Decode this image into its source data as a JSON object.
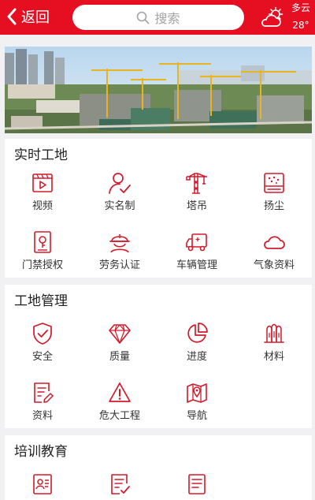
{
  "header": {
    "back_label": "返回",
    "search_placeholder": "搜索",
    "weather": {
      "condition": "多云",
      "temperature": "28°",
      "icon": "partly-cloudy-icon"
    }
  },
  "accent_color": "#e60f22",
  "sections": [
    {
      "title": "实时工地",
      "items": [
        {
          "label": "视频",
          "icon": "video-icon"
        },
        {
          "label": "实名制",
          "icon": "user-check-icon"
        },
        {
          "label": "塔吊",
          "icon": "tower-crane-icon"
        },
        {
          "label": "扬尘",
          "icon": "dust-monitor-icon"
        },
        {
          "label": "门禁授权",
          "icon": "access-control-icon"
        },
        {
          "label": "劳务认证",
          "icon": "worker-helmet-icon"
        },
        {
          "label": "车辆管理",
          "icon": "truck-icon"
        },
        {
          "label": "气象资料",
          "icon": "cloud-icon"
        }
      ]
    },
    {
      "title": "工地管理",
      "items": [
        {
          "label": "安全",
          "icon": "shield-check-icon"
        },
        {
          "label": "质量",
          "icon": "diamond-icon"
        },
        {
          "label": "进度",
          "icon": "pie-chart-icon"
        },
        {
          "label": "材料",
          "icon": "materials-icon"
        },
        {
          "label": "资料",
          "icon": "document-edit-icon"
        },
        {
          "label": "危大工程",
          "icon": "warning-icon"
        },
        {
          "label": "导航",
          "icon": "map-pin-icon"
        }
      ]
    },
    {
      "title": "培训教育",
      "items": [
        {
          "label": "",
          "icon": "id-card-icon"
        },
        {
          "label": "",
          "icon": "checklist-icon"
        },
        {
          "label": "",
          "icon": "document-icon"
        }
      ]
    }
  ]
}
